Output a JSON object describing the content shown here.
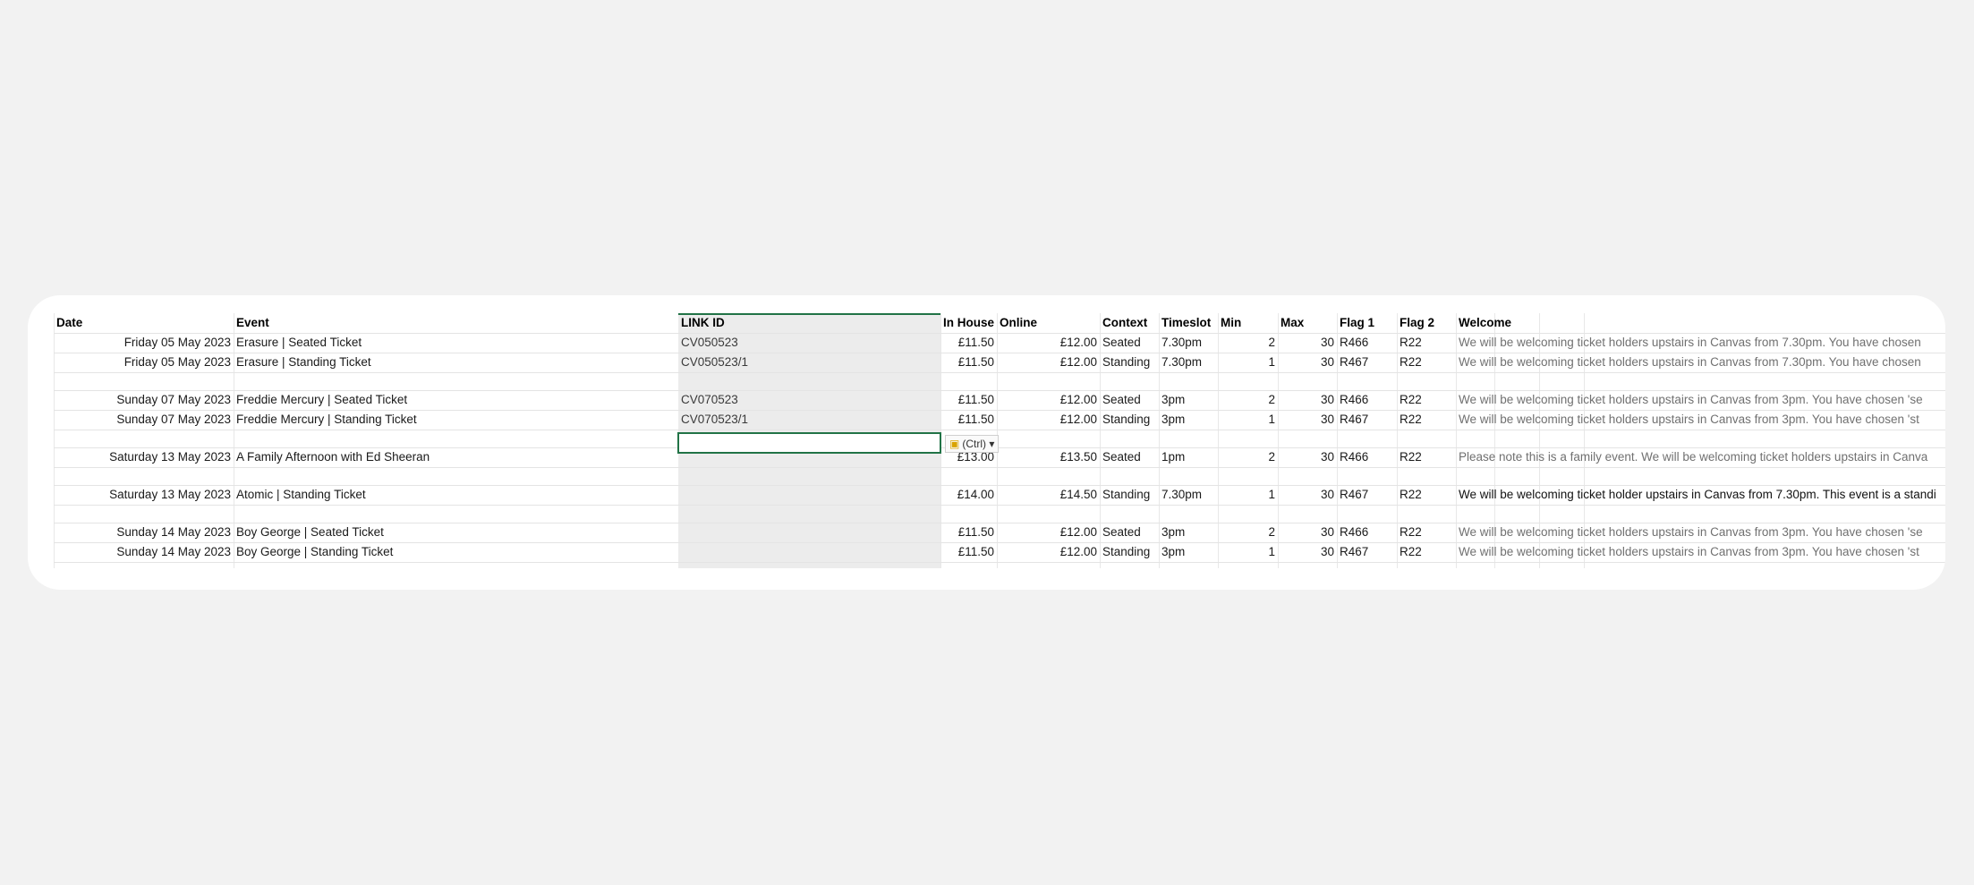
{
  "headers": [
    "Date",
    "Event",
    "LINK ID",
    "In House",
    "Online",
    "Context",
    "Timeslot",
    "Min",
    "Max",
    "Flag 1",
    "Flag 2",
    "Welcome"
  ],
  "rows": [
    {
      "date": "Friday 05 May 2023",
      "event": "Erasure | Seated Ticket",
      "link": "CV050523",
      "inhouse": "£11.50",
      "online": "£12.00",
      "context": "Seated",
      "timeslot": "7.30pm",
      "min": "2",
      "max": "30",
      "flag1": "R466",
      "flag2": "R22",
      "welcome": "We will be welcoming ticket holders upstairs in Canvas from 7.30pm.  You have chosen"
    },
    {
      "date": "Friday 05 May 2023",
      "event": "Erasure | Standing Ticket",
      "link": "CV050523/1",
      "inhouse": "£11.50",
      "online": "£12.00",
      "context": "Standing",
      "timeslot": "7.30pm",
      "min": "1",
      "max": "30",
      "flag1": "R467",
      "flag2": "R22",
      "welcome": "We will be welcoming ticket holders upstairs in Canvas from 7.30pm.  You have chosen"
    },
    {
      "date": "",
      "event": "",
      "link": "",
      "inhouse": "",
      "online": "",
      "context": "",
      "timeslot": "",
      "min": "",
      "max": "",
      "flag1": "",
      "flag2": "",
      "welcome": ""
    },
    {
      "date": "Sunday 07 May 2023",
      "event": "Freddie Mercury | Seated Ticket",
      "link": "CV070523",
      "inhouse": "£11.50",
      "online": "£12.00",
      "context": "Seated",
      "timeslot": "3pm",
      "min": "2",
      "max": "30",
      "flag1": "R466",
      "flag2": "R22",
      "welcome": "We will be welcoming ticket holders upstairs in Canvas from 3pm.  You have chosen 'se"
    },
    {
      "date": "Sunday 07 May 2023",
      "event": "Freddie Mercury | Standing Ticket",
      "link": "CV070523/1",
      "inhouse": "£11.50",
      "online": "£12.00",
      "context": "Standing",
      "timeslot": "3pm",
      "min": "1",
      "max": "30",
      "flag1": "R467",
      "flag2": "R22",
      "welcome": "We will be welcoming ticket holders upstairs in Canvas from 3pm.  You have chosen 'st"
    },
    {
      "date": "",
      "event": "",
      "link": "",
      "inhouse": "",
      "online": "",
      "context": "",
      "timeslot": "",
      "min": "",
      "max": "",
      "flag1": "",
      "flag2": "",
      "welcome": ""
    },
    {
      "date": "Saturday 13 May 2023",
      "event": "A Family Afternoon with Ed Sheeran",
      "link": "",
      "inhouse": "£13.00",
      "online": "£13.50",
      "context": "Seated",
      "timeslot": "1pm",
      "min": "2",
      "max": "30",
      "flag1": "R466",
      "flag2": "R22",
      "welcome": "Please note this is a family event.  We will be welcoming ticket holders upstairs in Canva"
    },
    {
      "date": "",
      "event": "",
      "link": "",
      "inhouse": "",
      "online": "",
      "context": "",
      "timeslot": "",
      "min": "",
      "max": "",
      "flag1": "",
      "flag2": "",
      "welcome": ""
    },
    {
      "date": "Saturday 13 May 2023",
      "event": "Atomic | Standing Ticket",
      "link": "",
      "inhouse": "£14.00",
      "online": "£14.50",
      "context": "Standing",
      "timeslot": "7.30pm",
      "min": "1",
      "max": "30",
      "flag1": "R467",
      "flag2": "R22",
      "welcome": "We will be welcoming ticket holder upstairs in Canvas from 7.30pm.  This event is a standi"
    },
    {
      "date": "",
      "event": "",
      "link": "",
      "inhouse": "",
      "online": "",
      "context": "",
      "timeslot": "",
      "min": "",
      "max": "",
      "flag1": "",
      "flag2": "",
      "welcome": ""
    },
    {
      "date": "Sunday 14 May 2023",
      "event": "Boy George | Seated Ticket",
      "link": "",
      "inhouse": "£11.50",
      "online": "£12.00",
      "context": "Seated",
      "timeslot": "3pm",
      "min": "2",
      "max": "30",
      "flag1": "R466",
      "flag2": "R22",
      "welcome": "We will be welcoming ticket holders upstairs in Canvas from 3pm.  You have chosen 'se"
    },
    {
      "date": "Sunday 14 May 2023",
      "event": "Boy George | Standing Ticket",
      "link": "",
      "inhouse": "£11.50",
      "online": "£12.00",
      "context": "Standing",
      "timeslot": "3pm",
      "min": "1",
      "max": "30",
      "flag1": "R467",
      "flag2": "R22",
      "welcome": "We will be welcoming ticket holders upstairs in Canvas from 3pm.  You have chosen 'st"
    }
  ],
  "paste_options": {
    "label": "(Ctrl)",
    "caret": "▾"
  },
  "accent_color": "#217346"
}
